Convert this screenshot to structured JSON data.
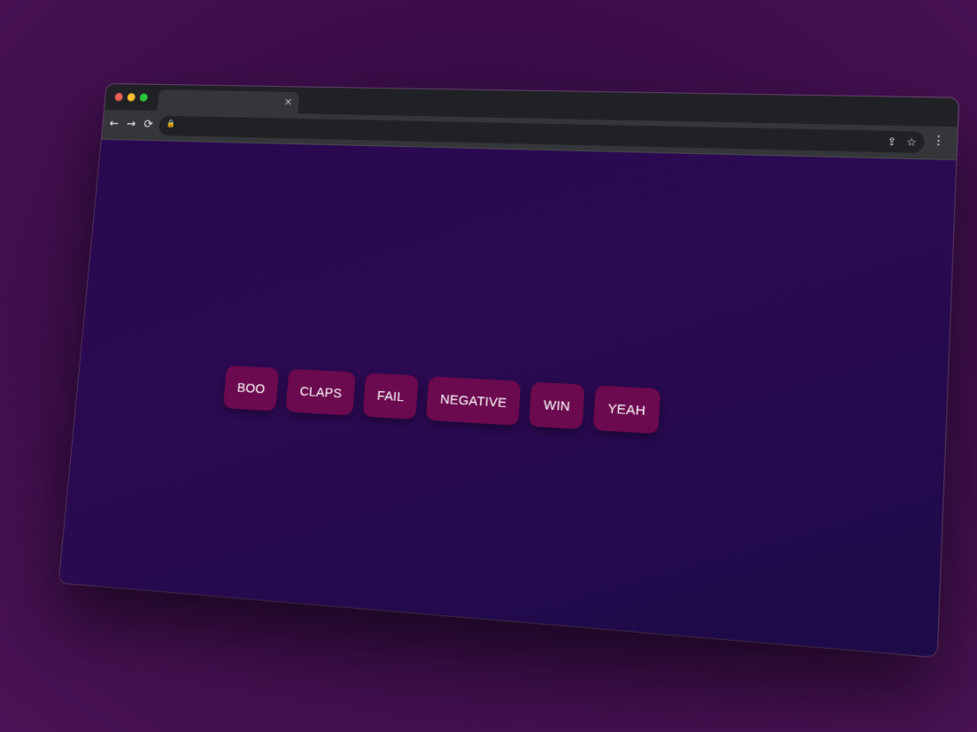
{
  "browser": {
    "tab": {
      "close_glyph": "×",
      "title": ""
    },
    "toolbar": {
      "back_glyph": "←",
      "forward_glyph": "→",
      "reload_glyph": "⟳",
      "lock_glyph": "🔒",
      "share_glyph": "⇪",
      "star_glyph": "☆",
      "menu_glyph": "⋮",
      "url": ""
    }
  },
  "sound_buttons": [
    {
      "label": "BOO"
    },
    {
      "label": "CLAPS"
    },
    {
      "label": "FAIL"
    },
    {
      "label": "NEGATIVE"
    },
    {
      "label": "WIN"
    },
    {
      "label": "YEAH"
    }
  ],
  "colors": {
    "button_bg": "#6b0a4e",
    "button_text": "#ffffff",
    "page_bg": "#2a0850",
    "chrome_dark": "#202124",
    "chrome_toolbar": "#35363a"
  },
  "icons": {
    "traffic_lights": [
      "close-dot",
      "minimize-dot",
      "maximize-dot"
    ],
    "nav": [
      "arrow-left-icon",
      "arrow-right-icon",
      "reload-icon"
    ],
    "omnibox": [
      "lock-icon",
      "share-icon",
      "star-icon"
    ],
    "menu": "more-vertical-icon"
  }
}
